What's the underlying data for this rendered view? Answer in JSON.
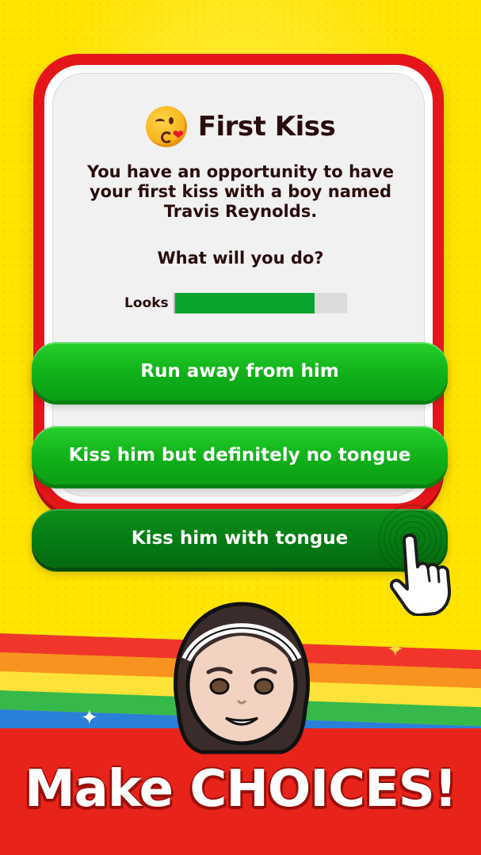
{
  "dialog": {
    "title": "First Kiss",
    "title_emoji": "face-blowing-kiss-emoji",
    "message": "You have an opportunity to have your first kiss with a boy named Travis Reynolds.",
    "question": "What will you do?",
    "stat": {
      "label": "Looks",
      "value_fraction": 0.81,
      "color": "#0ba52e"
    }
  },
  "choices": [
    {
      "label": "Run away from him",
      "style": "bright-green"
    },
    {
      "label": "Kiss him but definitely no tongue",
      "style": "bright-green"
    },
    {
      "label": "Kiss him with tongue",
      "style": "dark-green-pressed"
    }
  ],
  "promo": {
    "headline": "Make CHOICES!"
  },
  "colors": {
    "background": "#ffe400",
    "card_frame": "#e5161a",
    "button_green": "#10b019",
    "button_pressed": "#067914",
    "bottom_banner": "#e8231a"
  },
  "icons": [
    "pointing-hand-icon",
    "avatar-girl-headband",
    "sparkle-icon"
  ]
}
